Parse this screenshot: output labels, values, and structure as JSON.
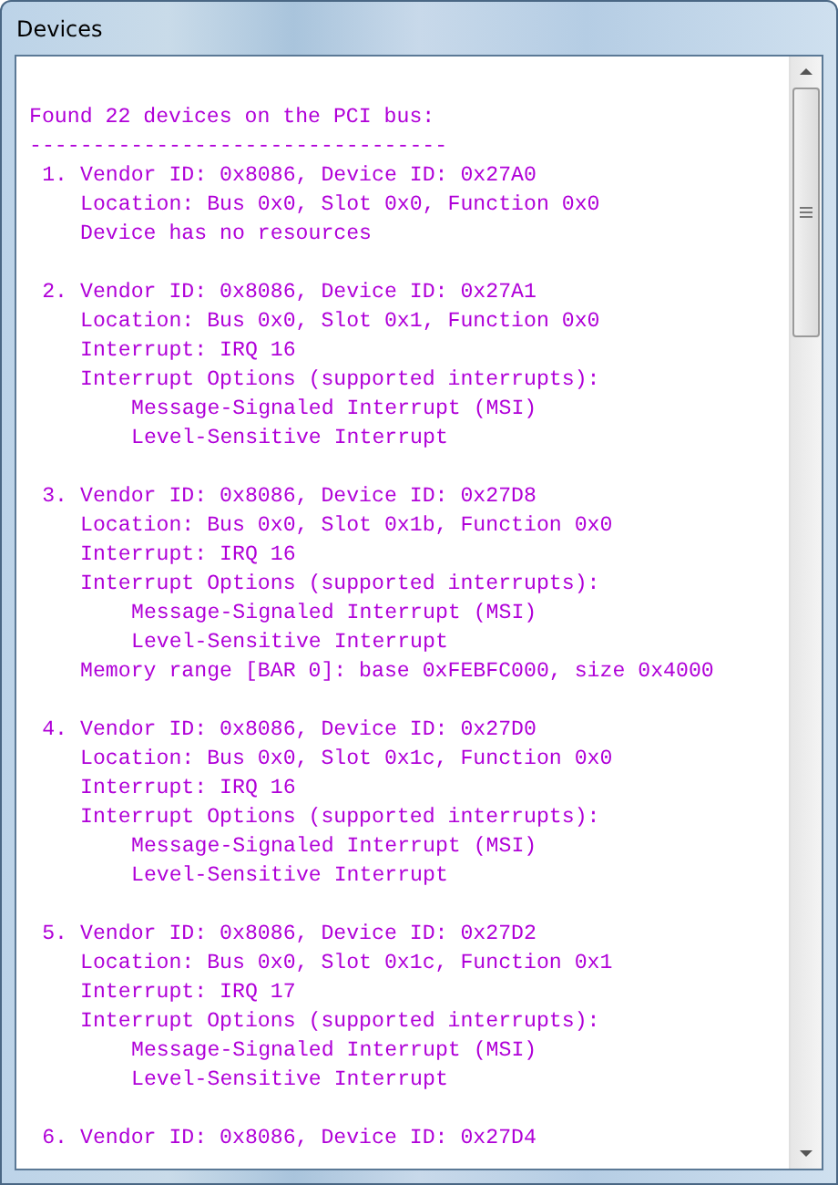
{
  "window": {
    "title": "Devices"
  },
  "output": {
    "header": "Found 22 devices on the PCI bus:",
    "separator": "---------------------------------",
    "devices": [
      {
        "number": "1.",
        "title": "Vendor ID: 0x8086, Device ID: 0x27A0",
        "lines": [
          {
            "kind": "field",
            "text": "Location: Bus 0x0, Slot 0x0, Function 0x0"
          },
          {
            "kind": "field",
            "text": "Device has no resources"
          }
        ]
      },
      {
        "number": "2.",
        "title": "Vendor ID: 0x8086, Device ID: 0x27A1",
        "lines": [
          {
            "kind": "field",
            "text": "Location: Bus 0x0, Slot 0x1, Function 0x0"
          },
          {
            "kind": "field",
            "text": "Interrupt: IRQ 16"
          },
          {
            "kind": "field",
            "text": "Interrupt Options (supported interrupts):"
          },
          {
            "kind": "option",
            "text": "Message-Signaled Interrupt (MSI)"
          },
          {
            "kind": "option",
            "text": "Level-Sensitive Interrupt"
          }
        ]
      },
      {
        "number": "3.",
        "title": "Vendor ID: 0x8086, Device ID: 0x27D8",
        "lines": [
          {
            "kind": "field",
            "text": "Location: Bus 0x0, Slot 0x1b, Function 0x0"
          },
          {
            "kind": "field",
            "text": "Interrupt: IRQ 16"
          },
          {
            "kind": "field",
            "text": "Interrupt Options (supported interrupts):"
          },
          {
            "kind": "option",
            "text": "Message-Signaled Interrupt (MSI)"
          },
          {
            "kind": "option",
            "text": "Level-Sensitive Interrupt"
          },
          {
            "kind": "field",
            "text": "Memory range [BAR 0]: base 0xFEBFC000, size 0x4000"
          }
        ]
      },
      {
        "number": "4.",
        "title": "Vendor ID: 0x8086, Device ID: 0x27D0",
        "lines": [
          {
            "kind": "field",
            "text": "Location: Bus 0x0, Slot 0x1c, Function 0x0"
          },
          {
            "kind": "field",
            "text": "Interrupt: IRQ 16"
          },
          {
            "kind": "field",
            "text": "Interrupt Options (supported interrupts):"
          },
          {
            "kind": "option",
            "text": "Message-Signaled Interrupt (MSI)"
          },
          {
            "kind": "option",
            "text": "Level-Sensitive Interrupt"
          }
        ]
      },
      {
        "number": "5.",
        "title": "Vendor ID: 0x8086, Device ID: 0x27D2",
        "lines": [
          {
            "kind": "field",
            "text": "Location: Bus 0x0, Slot 0x1c, Function 0x1"
          },
          {
            "kind": "field",
            "text": "Interrupt: IRQ 17"
          },
          {
            "kind": "field",
            "text": "Interrupt Options (supported interrupts):"
          },
          {
            "kind": "option",
            "text": "Message-Signaled Interrupt (MSI)"
          },
          {
            "kind": "option",
            "text": "Level-Sensitive Interrupt"
          }
        ]
      },
      {
        "number": "6.",
        "title": "Vendor ID: 0x8086, Device ID: 0x27D4"
      }
    ]
  }
}
